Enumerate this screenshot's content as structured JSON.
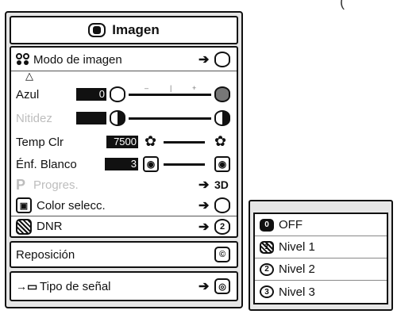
{
  "menu": {
    "title": "Imagen",
    "items": [
      {
        "id": "modo",
        "label": "Modo de imagen",
        "disabled": false
      },
      {
        "id": "azul",
        "label": "Azul",
        "value": "0",
        "disabled": false
      },
      {
        "id": "nitidez",
        "label": "Nitidez",
        "disabled": true
      },
      {
        "id": "temp",
        "label": "Temp Clr",
        "value": "7500",
        "disabled": false
      },
      {
        "id": "enf",
        "label": "Énf. Blanco",
        "value": "3",
        "disabled": false
      },
      {
        "id": "progres",
        "label": "Progres.",
        "badge": "3D",
        "disabled": true
      },
      {
        "id": "color",
        "label": "Color selecc.",
        "disabled": false
      },
      {
        "id": "dnr",
        "label": "DNR",
        "disabled": false
      },
      {
        "id": "reposicion",
        "label": "Reposición",
        "disabled": false
      },
      {
        "id": "tipo",
        "label": "Tipo de señal",
        "disabled": false
      }
    ]
  },
  "submenu": {
    "items": [
      {
        "label": "OFF",
        "icon": "off-icon"
      },
      {
        "label": "Nivel 1",
        "icon": "level-1-icon"
      },
      {
        "label": "Nivel 2",
        "icon": "level-2-icon"
      },
      {
        "label": "Nivel 3",
        "icon": "level-3-icon"
      }
    ]
  },
  "colors": {
    "frame": "#111111",
    "panel": "#ffffff",
    "border_bg": "#e6e6e6",
    "disabled_text": "#bdbdbd"
  }
}
